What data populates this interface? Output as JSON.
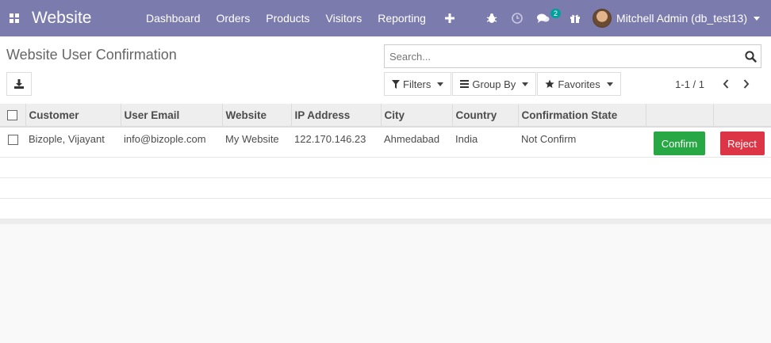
{
  "navbar": {
    "brand": "Website",
    "menu": [
      "Dashboard",
      "Orders",
      "Products",
      "Visitors",
      "Reporting"
    ],
    "plus_icon": "plus-icon",
    "messages_badge": "2",
    "user_name": "Mitchell Admin (db_test13)"
  },
  "control": {
    "title": "Website User Confirmation",
    "search_placeholder": "Search...",
    "filters_label": "Filters",
    "groupby_label": "Group By",
    "favorites_label": "Favorites",
    "pager_value": "1-1 / 1"
  },
  "table": {
    "columns": [
      "Customer",
      "User Email",
      "Website",
      "IP Address",
      "City",
      "Country",
      "Confirmation State"
    ],
    "rows": [
      {
        "customer": "Bizople, Vijayant",
        "email": "info@bizople.com",
        "website": "My Website",
        "ip": "122.170.146.23",
        "city": "Ahmedabad",
        "country": "India",
        "state": "Not Confirm",
        "confirm_label": "Confirm",
        "reject_label": "Reject"
      }
    ]
  },
  "colors": {
    "navbar": "#7c7bad",
    "confirm": "#28a745",
    "reject": "#dc3545",
    "badge": "#00a09d"
  }
}
